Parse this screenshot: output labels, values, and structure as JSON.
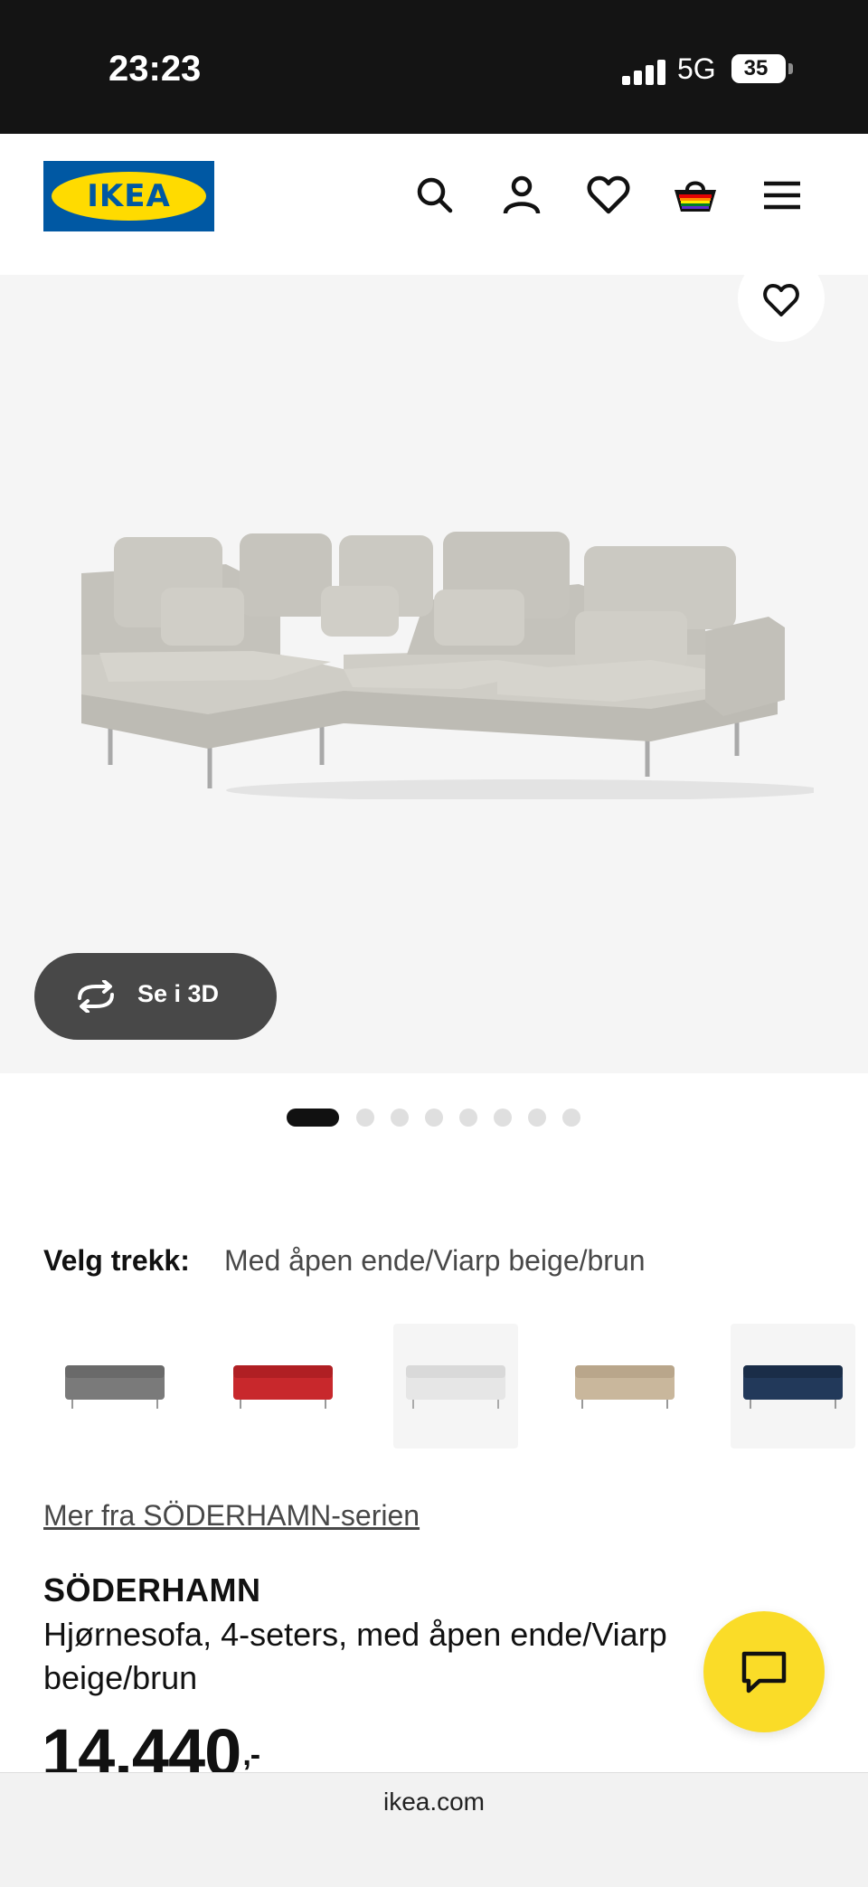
{
  "status_bar": {
    "time": "23:23",
    "network": "5G",
    "battery": "35"
  },
  "header": {
    "logo_text": "IKEA"
  },
  "gallery": {
    "view_3d_label": "Se i 3D",
    "image_count": 8,
    "active_image_index": 0
  },
  "cover": {
    "label": "Velg trekk:",
    "value": "Med åpen ende/Viarp beige/brun",
    "swatches": [
      {
        "name": "grey",
        "color": "#7a7a7a",
        "selected": false
      },
      {
        "name": "red",
        "color": "#c8282c",
        "selected": false
      },
      {
        "name": "white",
        "color": "#e6e6e6",
        "selected": true
      },
      {
        "name": "beige",
        "color": "#c9b79c",
        "selected": false
      },
      {
        "name": "blue",
        "color": "#22395a",
        "selected": false
      }
    ]
  },
  "product": {
    "series_link": "Mer fra SÖDERHAMN-serien",
    "name": "SÖDERHAMN",
    "description": "Hjørnesofa, 4-seters, med åpen ende/Viarp beige/brun",
    "price": "14.440",
    "price_suffix": ",-"
  },
  "browser": {
    "url": "ikea.com"
  },
  "colors": {
    "ikea_blue": "#0058a3",
    "ikea_yellow": "#ffdb00",
    "chat_yellow": "#fadc28",
    "sofa": "#c8c6c0"
  }
}
